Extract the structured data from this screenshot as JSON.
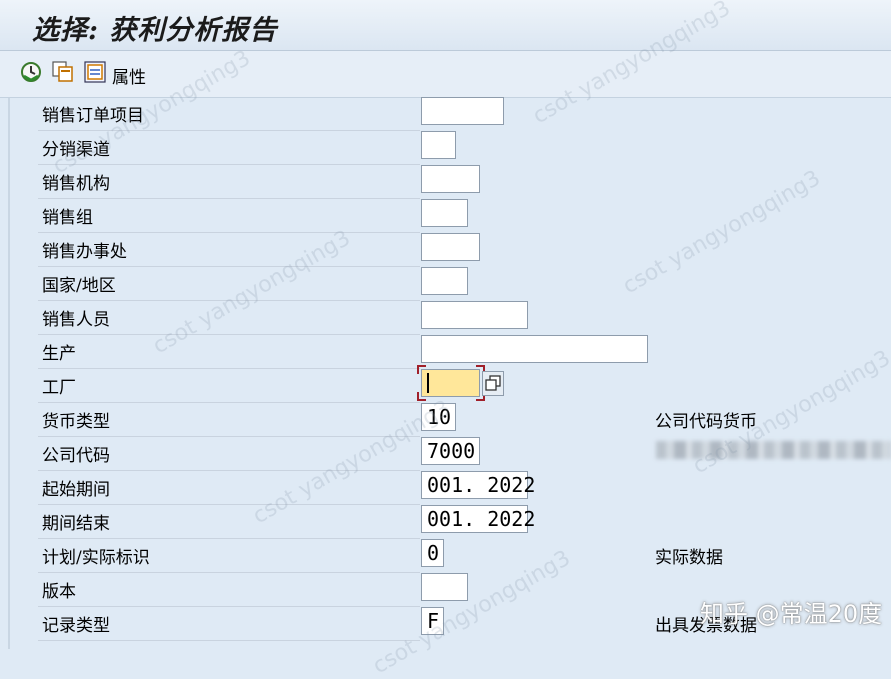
{
  "window": {
    "title": "选择: 获利分析报告"
  },
  "toolbar": {
    "execute_icon": "execute-clock-icon",
    "copy_icon": "variant-copy-icon",
    "attributes_icon": "attributes-icon",
    "attributes_label": "属性"
  },
  "fields": [
    {
      "label": "销售订单项目",
      "value": ""
    },
    {
      "label": "分销渠道",
      "value": ""
    },
    {
      "label": "销售机构",
      "value": ""
    },
    {
      "label": "销售组",
      "value": ""
    },
    {
      "label": "销售办事处",
      "value": ""
    },
    {
      "label": "国家/地区",
      "value": ""
    },
    {
      "label": "销售人员",
      "value": ""
    },
    {
      "label": "生产",
      "value": ""
    },
    {
      "label": "工厂",
      "value": ""
    },
    {
      "label": "货币类型",
      "value": "10",
      "description": "公司代码货币"
    },
    {
      "label": "公司代码",
      "value": "7000"
    },
    {
      "label": "起始期间",
      "value": "001. 2022"
    },
    {
      "label": "期间结束",
      "value": "001. 2022"
    },
    {
      "label": "计划/实际标识",
      "value": "0",
      "description": "实际数据"
    },
    {
      "label": "版本",
      "value": ""
    },
    {
      "label": "记录类型",
      "value": "F",
      "description": "出具发票数据"
    }
  ],
  "watermarks": [
    "csot yangyongqing3"
  ],
  "brand_watermark": "知乎 @常温20度",
  "colors": {
    "background": "#dfeaf5",
    "focus_field": "#ffe79a",
    "focus_corner": "#a0202a"
  }
}
